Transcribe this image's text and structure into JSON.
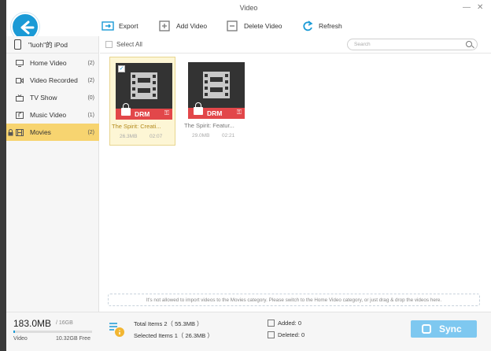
{
  "window": {
    "title": "Video",
    "minimize": "—",
    "close": "✕"
  },
  "toolbar": {
    "export_label": "Export",
    "add_video_label": "Add Video",
    "delete_video_label": "Delete Video",
    "refresh_label": "Refresh"
  },
  "sidebar": {
    "device_name": "\"luoh\"的 iPod",
    "items": [
      {
        "label": "Home Video",
        "count": "(2)",
        "icon": "home-video-icon"
      },
      {
        "label": "Video Recorded",
        "count": "(2)",
        "icon": "video-recorded-icon"
      },
      {
        "label": "TV Show",
        "count": "(0)",
        "icon": "tv-show-icon"
      },
      {
        "label": "Music Video",
        "count": "(1)",
        "icon": "music-video-icon"
      },
      {
        "label": "Movies",
        "count": "(2)",
        "icon": "movies-icon",
        "active": true
      }
    ]
  },
  "content": {
    "select_all_label": "Select All",
    "search_placeholder": "Search",
    "videos": [
      {
        "title": "The Spirit: Creati...",
        "size": "26.3MB",
        "duration": "02:07",
        "drm_label": "DRM",
        "selected": true
      },
      {
        "title": "The Spirit: Featur...",
        "size": "29.0MB",
        "duration": "02:21",
        "drm_label": "DRM",
        "selected": false
      }
    ],
    "notice": "It's not allowed to  import videos to the Movies category.  Please switch to the Home Video category, or just drag & drop the videos here."
  },
  "footer": {
    "used": "183.0MB",
    "total": "/ 16GB",
    "used_fraction": 0.011,
    "category_label": "Video",
    "free": "10.32GB Free",
    "total_items": "Total Items 2（ 55.3MB ）",
    "selected_items": "Selected Items 1（ 26.3MB ）",
    "added": "Added: 0",
    "deleted": "Deleted: 0",
    "sync_label": "Sync"
  },
  "colors": {
    "accent": "#1a9ad6",
    "active_item": "#f7d470",
    "drm_red": "#e2474a",
    "sync_button": "#7ec8f0"
  }
}
